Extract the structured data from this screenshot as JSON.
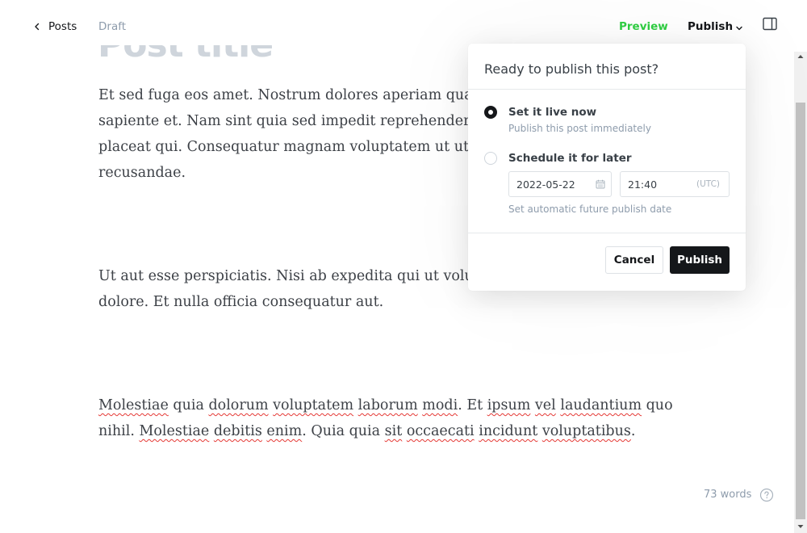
{
  "header": {
    "back_label": "Posts",
    "status": "Draft",
    "preview_label": "Preview",
    "publish_label": "Publish",
    "back_icon": "chevron-left-icon",
    "publish_icon": "chevron-down-icon",
    "sidebar_icon": "sidebar-toggle-icon",
    "preview_color": "#30cf43"
  },
  "editor": {
    "title": "Post title",
    "paragraphs": [
      [
        "Et sed fuga eos amet. Nostrum dolores aperiam qua",
        "sapiente et. Nam sint quia sed impedit reprehender",
        "placeat qui. Consequatur magnam voluptatem ut ut",
        "recusandae."
      ],
      [
        "Ut aut esse perspiciatis. Nisi ab expedita qui ut volu",
        "dolore. Et nulla officia consequatur aut."
      ],
      [
        [
          {
            "t": "Molestiae",
            "s": true
          },
          {
            "t": " quia ",
            "s": false
          },
          {
            "t": "dolorum",
            "s": true
          },
          {
            "t": " ",
            "s": false
          },
          {
            "t": "voluptatem",
            "s": true
          },
          {
            "t": " ",
            "s": false
          },
          {
            "t": "laborum",
            "s": true
          },
          {
            "t": " ",
            "s": false
          },
          {
            "t": "modi",
            "s": true
          },
          {
            "t": ". Et ",
            "s": false
          },
          {
            "t": "ipsum",
            "s": true
          },
          {
            "t": " ",
            "s": false
          },
          {
            "t": "vel",
            "s": true
          },
          {
            "t": " ",
            "s": false
          },
          {
            "t": "laudantium",
            "s": true
          },
          {
            "t": " quo",
            "s": false
          }
        ],
        [
          {
            "t": "nihil. ",
            "s": false
          },
          {
            "t": "Molestiae",
            "s": true
          },
          {
            "t": " ",
            "s": false
          },
          {
            "t": "debitis",
            "s": true
          },
          {
            "t": " ",
            "s": false
          },
          {
            "t": "enim",
            "s": true
          },
          {
            "t": ". Quia quia ",
            "s": false
          },
          {
            "t": "sit",
            "s": true
          },
          {
            "t": " ",
            "s": false
          },
          {
            "t": "occaecati",
            "s": true
          },
          {
            "t": " ",
            "s": false
          },
          {
            "t": "incidunt",
            "s": true
          },
          {
            "t": " ",
            "s": false
          },
          {
            "t": "voluptatibus",
            "s": true
          },
          {
            "t": ".",
            "s": false
          }
        ]
      ]
    ],
    "word_count": "73 words",
    "help_icon": "question-circle-icon"
  },
  "publish_popover": {
    "title": "Ready to publish this post?",
    "options": [
      {
        "label": "Set it live now",
        "description": "Publish this post immediately",
        "selected": true
      },
      {
        "label": "Schedule it for later",
        "description": "",
        "selected": false
      }
    ],
    "date_value": "2022-05-22",
    "date_icon": "calendar-icon",
    "time_value": "21:40",
    "timezone": "(UTC)",
    "schedule_hint": "Set automatic future publish date",
    "cancel_label": "Cancel",
    "confirm_label": "Publish"
  }
}
